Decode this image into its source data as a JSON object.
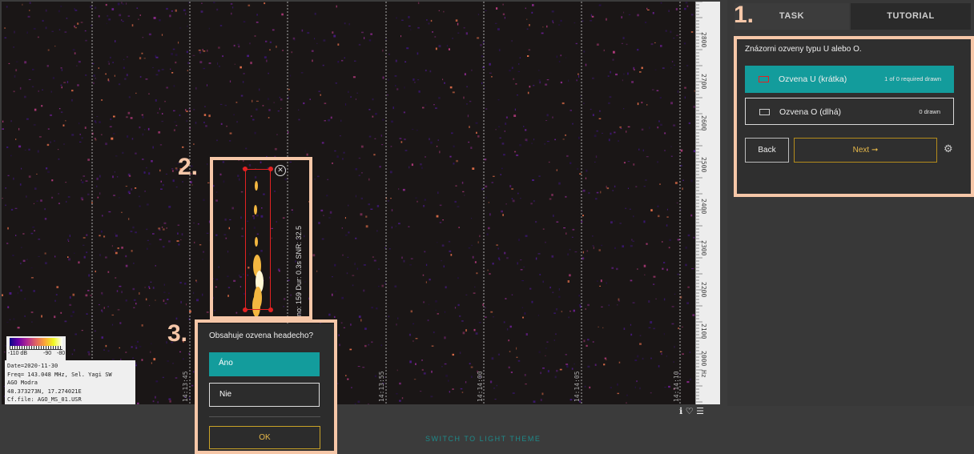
{
  "sidebar": {
    "tabs": [
      {
        "label": "TASK",
        "active": true
      },
      {
        "label": "TUTORIAL",
        "active": false
      }
    ],
    "instruction": "Znázorni ozveny typu U alebo O.",
    "tools": [
      {
        "name": "Ozvena U (krátka)",
        "status": "1 of 0 required drawn",
        "active": true,
        "color": "#e32222"
      },
      {
        "name": "Ozvena O (dlhá)",
        "status": "0 drawn",
        "active": false,
        "color": "#cccccc"
      }
    ],
    "back_label": "Back",
    "next_label": "Next ➞",
    "settings_icon": "gear-icon"
  },
  "viewer": {
    "frequency_ticks": [
      "2800",
      "2700",
      "2600",
      "2500",
      "2400",
      "2300",
      "2200",
      "2100",
      "2000 Hz"
    ],
    "time_labels": [
      "14:13:45",
      "14:13:55",
      "14:14:00",
      "14:14:05",
      "14:14:10"
    ],
    "colorbar": {
      "min": "-110 dB",
      "mid": "-90",
      "max": "-80"
    },
    "info": [
      "Date=2020-11-30",
      "Freq= 143.048 MHz, Sel. Yagi SW",
      "AGO Modra",
      "48.373273N, 17.274021E",
      "Cf.file: AGO_MS_01.USR"
    ],
    "annotation_label": "no: 159  Dur: 0.3s  SNR: 32.5"
  },
  "popup": {
    "question": "Obsahuje ozvena headecho?",
    "options": [
      "Áno",
      "Nie"
    ],
    "ok_label": "OK"
  },
  "markers": [
    "1.",
    "2.",
    "3."
  ],
  "footer": {
    "switch_theme": "SWITCH TO LIGHT THEME"
  },
  "colors": {
    "accent": "#139c9c",
    "highlight": "#f6c7a8",
    "annotation": "#e32222",
    "next": "#e6b84a"
  }
}
